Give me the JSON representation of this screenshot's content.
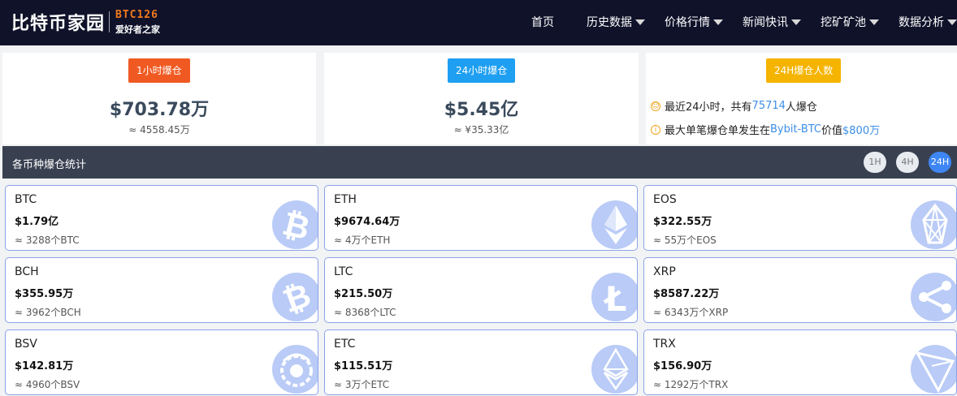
{
  "header": {
    "logo_main": "比特币家园",
    "logo_code": "BTC126",
    "logo_tagline": "爱好者之家",
    "nav": [
      {
        "label": "首页",
        "dropdown": false
      },
      {
        "label": "历史数据",
        "dropdown": true
      },
      {
        "label": "价格行情",
        "dropdown": true
      },
      {
        "label": "新闻快讯",
        "dropdown": true
      },
      {
        "label": "挖矿矿池",
        "dropdown": true
      },
      {
        "label": "数据分析",
        "dropdown": true
      }
    ]
  },
  "stats": {
    "hour1": {
      "tag": "1小时爆仓",
      "tag_color": "#f05a22",
      "value": "$703.78万",
      "sub": "≈ 4558.45万"
    },
    "hour24": {
      "tag": "24小时爆仓",
      "tag_color": "#1e9ff2",
      "value": "$5.45亿",
      "sub": "≈ ¥35.33亿"
    },
    "people": {
      "tag": "24H爆仓人数",
      "tag_color": "#f5b400",
      "line1_pre": "最近24小时，共有",
      "line1_num": "75714",
      "line1_post": "人爆仓",
      "line2_pre": "最大单笔爆仓单发生在",
      "line2_exchange": "Bybit-BTC",
      "line2_mid": "价值",
      "line2_value": "$800万"
    }
  },
  "section": {
    "title": "各币种爆仓统计",
    "buttons": [
      "1H",
      "4H",
      "24H"
    ],
    "active": "24H"
  },
  "coins": [
    {
      "name": "BTC",
      "value": "$1.79亿",
      "sub": "≈ 3288个BTC",
      "icon": "bitcoin-icon"
    },
    {
      "name": "ETH",
      "value": "$9674.64万",
      "sub": "≈ 4万个ETH",
      "icon": "ethereum-icon"
    },
    {
      "name": "EOS",
      "value": "$322.55万",
      "sub": "≈ 55万个EOS",
      "icon": "eos-icon"
    },
    {
      "name": "BCH",
      "value": "$355.95万",
      "sub": "≈ 3962个BCH",
      "icon": "bitcoin-cash-icon"
    },
    {
      "name": "LTC",
      "value": "$215.50万",
      "sub": "≈ 8368个LTC",
      "icon": "litecoin-icon"
    },
    {
      "name": "XRP",
      "value": "$8587.22万",
      "sub": "≈ 6343万个XRP",
      "icon": "ripple-icon"
    },
    {
      "name": "BSV",
      "value": "$142.81万",
      "sub": "≈ 4960个BSV",
      "icon": "bsv-dragon-icon"
    },
    {
      "name": "ETC",
      "value": "$115.51万",
      "sub": "≈ 3万个ETC",
      "icon": "ethereum-classic-icon"
    },
    {
      "name": "TRX",
      "value": "$156.90万",
      "sub": "≈ 1292万个TRX",
      "icon": "tron-icon"
    }
  ]
}
